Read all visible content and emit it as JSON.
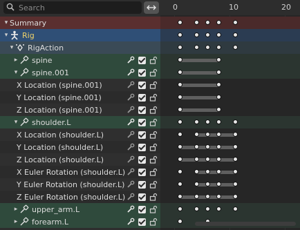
{
  "search": {
    "placeholder": "Search"
  },
  "ruler": {
    "ticks": [
      "0",
      "10",
      "20"
    ]
  },
  "rows": [
    {
      "label": "Summary",
      "type": "summary"
    },
    {
      "label": "Rig",
      "type": "rig"
    },
    {
      "label": "RigAction",
      "type": "action"
    },
    {
      "label": "spine",
      "type": "group"
    },
    {
      "label": "spine.001",
      "type": "group"
    },
    {
      "label": "X Location (spine.001)",
      "type": "chan"
    },
    {
      "label": "Y Location (spine.001)",
      "type": "chan"
    },
    {
      "label": "Z Location (spine.001)",
      "type": "chan"
    },
    {
      "label": "shoulder.L",
      "type": "group"
    },
    {
      "label": "X Location (shoulder.L)",
      "type": "chan"
    },
    {
      "label": "Y Location (shoulder.L)",
      "type": "chan"
    },
    {
      "label": "Z Location (shoulder.L)",
      "type": "chan"
    },
    {
      "label": "X Euler Rotation (shoulder.L)",
      "type": "chan"
    },
    {
      "label": "Y Euler Rotation (shoulder.L)",
      "type": "chan"
    },
    {
      "label": "Z Euler Rotation (shoulder.L)",
      "type": "chan"
    },
    {
      "label": "upper_arm.L",
      "type": "group"
    },
    {
      "label": "forearm.L",
      "type": "group"
    }
  ],
  "keyframes": [
    [
      1,
      4,
      6,
      8,
      11
    ],
    [
      1,
      4,
      6,
      8,
      11
    ],
    [
      1,
      4,
      6,
      8,
      11
    ],
    [
      1,
      8
    ],
    [
      1,
      8
    ],
    [
      1,
      8
    ],
    [
      1,
      8
    ],
    [
      1,
      8
    ],
    [
      1,
      4,
      6,
      8,
      11
    ],
    [
      1,
      4,
      6,
      8,
      11
    ],
    [
      1,
      4,
      6,
      8,
      11
    ],
    [
      1,
      4,
      6,
      8,
      11
    ],
    [
      1,
      4,
      6,
      8,
      11
    ],
    [
      1,
      4,
      6,
      8,
      11
    ],
    [
      1,
      4,
      6,
      8,
      11
    ],
    [
      1,
      4,
      6,
      8,
      11
    ],
    [
      1,
      6
    ]
  ],
  "holds": [
    [],
    [],
    [],
    [
      [
        1,
        8
      ]
    ],
    [
      [
        1,
        8
      ]
    ],
    [
      [
        1,
        8
      ]
    ],
    [
      [
        1,
        8
      ]
    ],
    [
      [
        1,
        8
      ]
    ],
    [],
    [
      [
        4,
        11
      ]
    ],
    [
      [
        1,
        11
      ]
    ],
    [
      [
        1,
        11
      ]
    ],
    [
      [
        4,
        11
      ]
    ],
    [
      [
        4,
        11
      ]
    ],
    [
      [
        1,
        11
      ]
    ],
    [],
    []
  ],
  "colors": {
    "accent_rig": "#2f4f76",
    "summary": "#5a2f2f",
    "group": "#2f4a3c"
  }
}
